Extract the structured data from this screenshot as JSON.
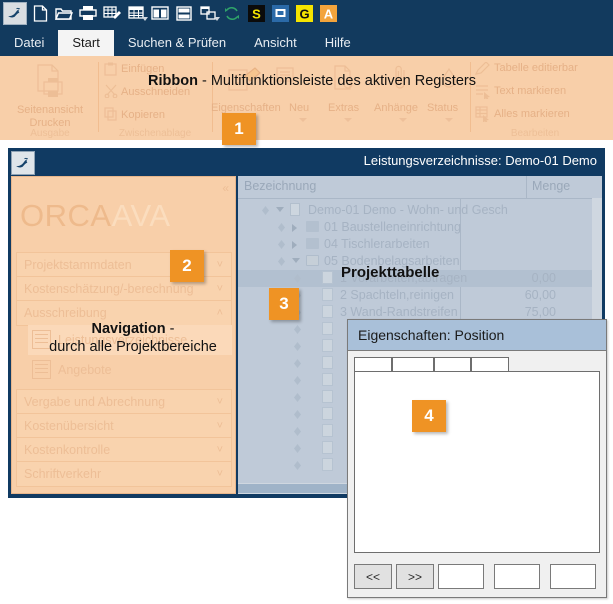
{
  "toolbar": {
    "icons": [
      {
        "name": "orca-dolphin-icon",
        "selected": true
      },
      {
        "name": "new-document-icon",
        "selected": false
      },
      {
        "name": "open-folder-icon",
        "selected": false
      },
      {
        "name": "print-icon",
        "selected": false
      },
      {
        "name": "edit-table-icon",
        "selected": false
      },
      {
        "name": "table-layout-icon",
        "selected": false,
        "caret": true
      },
      {
        "name": "split-vertical-icon",
        "selected": false
      },
      {
        "name": "split-horizontal-icon",
        "selected": false
      },
      {
        "name": "window-arrange-icon",
        "selected": false,
        "caret": true
      },
      {
        "name": "refresh-sync-icon",
        "selected": false
      },
      {
        "name": "s-badge-icon",
        "selected": false
      },
      {
        "name": "screen-badge-icon",
        "selected": false
      },
      {
        "name": "g-badge-icon",
        "selected": false
      },
      {
        "name": "a-badge-icon",
        "selected": false
      }
    ]
  },
  "ribbon_tabs": [
    {
      "label": "Datei",
      "active": false
    },
    {
      "label": "Start",
      "active": true
    },
    {
      "label": "Suchen & Prüfen",
      "active": false
    },
    {
      "label": "Ansicht",
      "active": false
    },
    {
      "label": "Hilfe",
      "active": false
    }
  ],
  "ribbon": {
    "groups": [
      {
        "label": "Ausgabe",
        "items": [
          "Seitenansicht",
          "Drucken"
        ]
      },
      {
        "label": "Zwischenablage",
        "items": [
          "Einfügen",
          "Ausschneiden",
          "Kopieren"
        ]
      },
      {
        "label": "",
        "items": [
          "Eigenschaften",
          "Neu",
          "Extras",
          "Anhänge",
          "Status"
        ]
      },
      {
        "label": "Bearbeiten",
        "items": [
          "Tabelle editierbar",
          "Text markieren",
          "Alles markieren"
        ]
      }
    ]
  },
  "annotations": [
    {
      "number": "1",
      "title": "Ribbon",
      "rest": " - Multifunktionsleiste des aktiven Registers"
    },
    {
      "number": "2",
      "title": "Navigation",
      "rest": " -",
      "line2": "durch alle Projektbereiche"
    },
    {
      "number": "3",
      "title": "Projekttabelle",
      "rest": ""
    },
    {
      "number": "4",
      "title": "",
      "rest": ""
    }
  ],
  "document_window": {
    "title": "Leistungsverzeichnisse: Demo-01 Demo",
    "icon": "orca-dolphin-icon"
  },
  "navigation": {
    "collapse_icon": "«",
    "logo_primary": "ORCA",
    "logo_secondary": "AVA",
    "items": [
      {
        "label": "Projektstammdaten",
        "chevron": "˅",
        "expanded": false
      },
      {
        "label": "Kostenschätzung/-berechnung",
        "chevron": "˅",
        "expanded": false
      },
      {
        "label": "Ausschreibung",
        "chevron": "˄",
        "expanded": true
      },
      {
        "label": "Vergabe und Abrechnung",
        "chevron": "˅",
        "expanded": false
      },
      {
        "label": "Kostenübersicht",
        "chevron": "˅",
        "expanded": false
      },
      {
        "label": "Kostenkontrolle",
        "chevron": "˅",
        "expanded": false
      },
      {
        "label": "Schriftverkehr",
        "chevron": "˅",
        "expanded": false
      }
    ],
    "sub_items": [
      {
        "label": "Leistungsverzeichnisse",
        "selected": true
      },
      {
        "label": "Angebote",
        "selected": false
      }
    ]
  },
  "tree": {
    "columns": [
      {
        "label": "Bezeichnung"
      },
      {
        "label": "Menge"
      }
    ],
    "rows": [
      {
        "label": "Demo-01 Demo - Wohn- und Gesch",
        "qty": "",
        "indent": 0,
        "expander": "down",
        "icon": "book",
        "diamond": true
      },
      {
        "label": "01 Baustelleneinrichtung",
        "qty": "",
        "indent": 1,
        "expander": "right",
        "icon": "folder",
        "diamond": true
      },
      {
        "label": "04 Tischlerarbeiten",
        "qty": "",
        "indent": 1,
        "expander": "right",
        "icon": "folder",
        "diamond": true
      },
      {
        "label": "05 Bodenbelagsarbeiten",
        "qty": "",
        "indent": 1,
        "expander": "down",
        "icon": "folder-open",
        "diamond": true
      },
      {
        "label": "1 Vorarbeiten,abtragen",
        "qty": "0,00",
        "indent": 2,
        "expander": "",
        "icon": "doc",
        "diamond": true,
        "highlight": true
      },
      {
        "label": "2 Spachteln,reinigen",
        "qty": "60,00",
        "indent": 2,
        "expander": "",
        "icon": "doc",
        "diamond": true
      },
      {
        "label": "3 Wand-Randstreifen",
        "qty": "75,00",
        "indent": 2,
        "expander": "",
        "icon": "doc",
        "diamond": true
      },
      {
        "label": "",
        "qty": "",
        "indent": 2,
        "expander": "",
        "icon": "doc",
        "diamond": true
      },
      {
        "label": "",
        "qty": "",
        "indent": 2,
        "expander": "",
        "icon": "doc",
        "diamond": true
      },
      {
        "label": "",
        "qty": "",
        "indent": 2,
        "expander": "",
        "icon": "doc",
        "diamond": true
      },
      {
        "label": "",
        "qty": "",
        "indent": 2,
        "expander": "",
        "icon": "doc",
        "diamond": true
      },
      {
        "label": "",
        "qty": "",
        "indent": 2,
        "expander": "",
        "icon": "doc",
        "diamond": true
      },
      {
        "label": "",
        "qty": "",
        "indent": 2,
        "expander": "",
        "icon": "doc",
        "diamond": true
      },
      {
        "label": "",
        "qty": "",
        "indent": 2,
        "expander": "",
        "icon": "doc",
        "diamond": true
      },
      {
        "label": "",
        "qty": "",
        "indent": 2,
        "expander": "",
        "icon": "doc",
        "diamond": true
      },
      {
        "label": "",
        "qty": "",
        "indent": 2,
        "expander": "",
        "icon": "doc",
        "diamond": true
      }
    ]
  },
  "dialog": {
    "title": "Eigenschaften: Position",
    "tabs": [
      "",
      "",
      "",
      ""
    ],
    "buttons": {
      "prev": "<<",
      "next": ">>"
    },
    "fields": [
      "",
      "",
      ""
    ]
  },
  "colors": {
    "window_blue": "#103a62",
    "toolbar_blue": "#123a5e",
    "ribbon_peach": "#f8cfa9",
    "callout_orange": "#ef9324",
    "tree_blue_grey": "#bfcad8",
    "dialog_title_blue": "#a9c0d9"
  }
}
